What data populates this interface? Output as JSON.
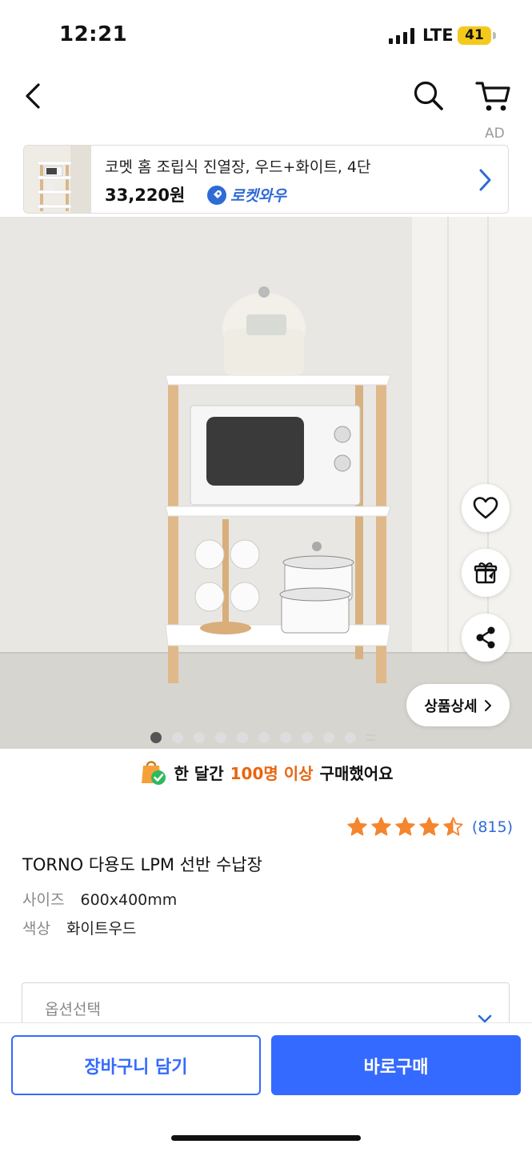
{
  "status_bar": {
    "time": "12:21",
    "network": "LTE",
    "battery": "41"
  },
  "nav": {
    "back_icon": "chevron-left-icon",
    "search_icon": "search-icon",
    "cart_icon": "cart-icon"
  },
  "ad": {
    "label": "AD",
    "title": "코멧 홈 조립식 진열장, 우드+화이트, 4단",
    "price": "33,220원",
    "badge": "로켓와우"
  },
  "gallery": {
    "dot_count": 10,
    "active_index": 0,
    "actions": [
      "heart-icon",
      "gift-icon",
      "share-icon"
    ],
    "detail_button": "상품상세"
  },
  "purchase_note": {
    "prefix": "한 달간",
    "highlight": "100명 이상",
    "suffix": "구매했어요"
  },
  "rating": {
    "stars": 4.5,
    "count": "(815)"
  },
  "product": {
    "name": "TORNO 다용도 LPM 선반 수납장",
    "attributes": [
      {
        "key": "사이즈",
        "value": "600x400mm"
      },
      {
        "key": "색상",
        "value": "화이트우드"
      }
    ]
  },
  "option": {
    "placeholder": "옵션선택"
  },
  "bottom_bar": {
    "cart_label": "장바구니 담기",
    "buy_label": "바로구매"
  },
  "colors": {
    "primary": "#346aff",
    "highlight": "#e9650f",
    "star": "#f5852e"
  }
}
